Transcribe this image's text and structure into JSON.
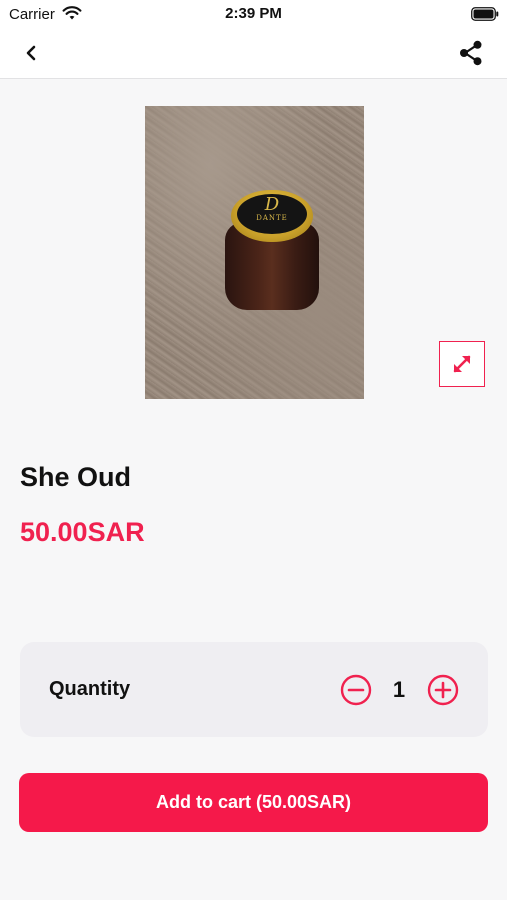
{
  "status_bar": {
    "carrier": "Carrier",
    "time": "2:39 PM",
    "wifi_icon": "wifi-icon",
    "battery_icon": "battery-icon"
  },
  "nav": {
    "back_icon": "chevron-left-icon",
    "share_icon": "share-icon"
  },
  "product": {
    "image_icon": "expand-icon",
    "image_lid_monogram": "D",
    "image_lid_brand": "DANTE",
    "name": "She Oud",
    "price": "50.00SAR"
  },
  "quantity": {
    "label": "Quantity",
    "value": "1",
    "minus_icon": "minus-circle-icon",
    "plus_icon": "plus-circle-icon"
  },
  "cart": {
    "button_label": "Add to cart (50.00SAR)"
  },
  "colors": {
    "accent": "#f0214f",
    "button": "#f5194a",
    "background": "#f7f7f8",
    "card": "#efeef2"
  }
}
